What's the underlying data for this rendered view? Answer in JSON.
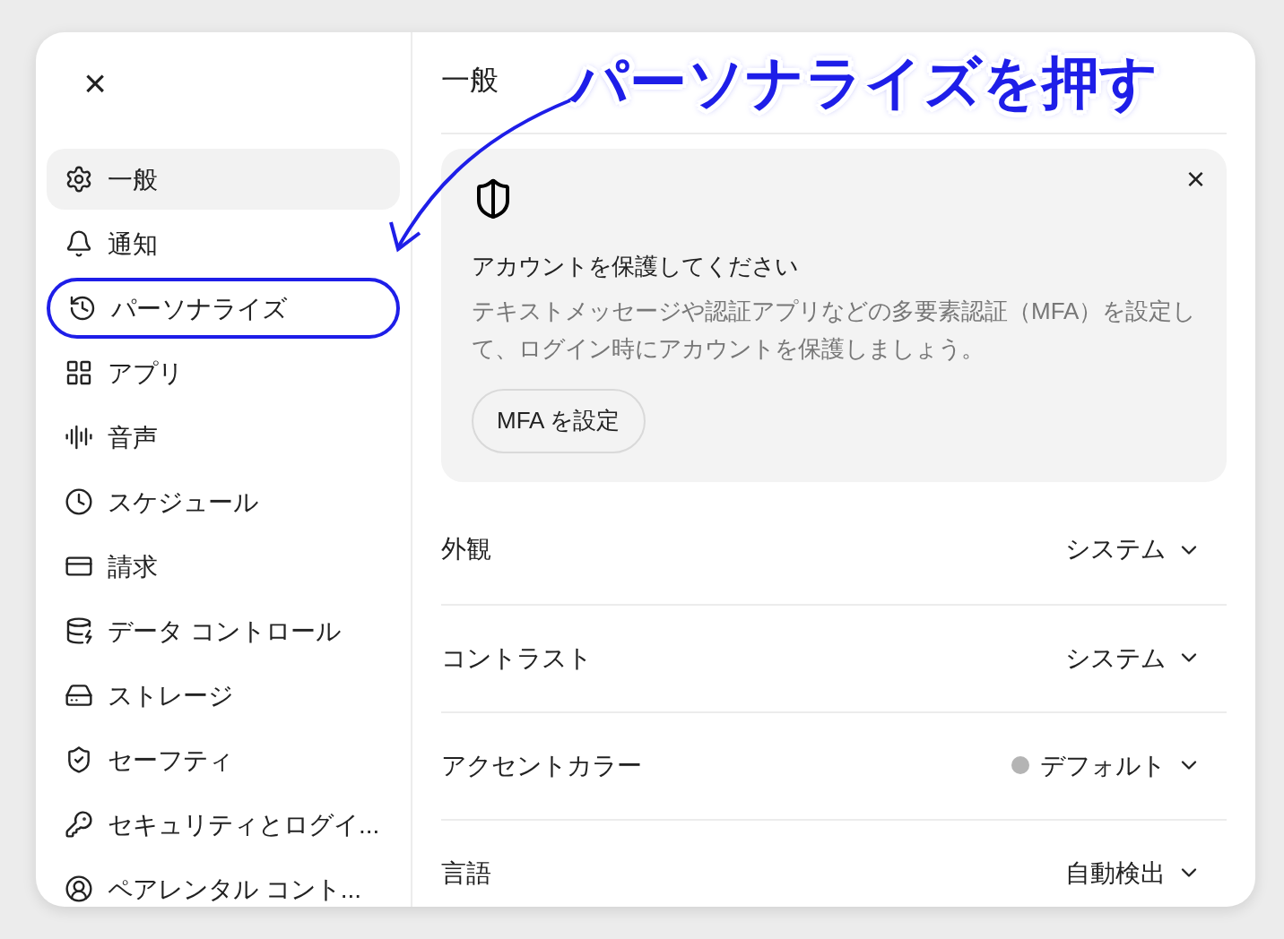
{
  "sidebar": {
    "close": "×",
    "items": [
      {
        "label": "一般",
        "selected": true,
        "highlighted": false
      },
      {
        "label": "通知",
        "selected": false,
        "highlighted": false
      },
      {
        "label": "パーソナライズ",
        "selected": false,
        "highlighted": true
      },
      {
        "label": "アプリ",
        "selected": false,
        "highlighted": false
      },
      {
        "label": "音声",
        "selected": false,
        "highlighted": false
      },
      {
        "label": "スケジュール",
        "selected": false,
        "highlighted": false
      },
      {
        "label": "請求",
        "selected": false,
        "highlighted": false
      },
      {
        "label": "データ コントロール",
        "selected": false,
        "highlighted": false
      },
      {
        "label": "ストレージ",
        "selected": false,
        "highlighted": false
      },
      {
        "label": "セーフティ",
        "selected": false,
        "highlighted": false
      },
      {
        "label": "セキュリティとログイ...",
        "selected": false,
        "highlighted": false
      },
      {
        "label": "ペアレンタル コント...",
        "selected": false,
        "highlighted": false
      }
    ]
  },
  "panel": {
    "title": "一般",
    "banner": {
      "close": "×",
      "title": "アカウントを保護してください",
      "body": "テキストメッセージや認証アプリなどの多要素認証（MFA）を設定して、ログイン時にアカウントを保護しましょう。",
      "button": "MFA を設定"
    },
    "settings": [
      {
        "label": "外観",
        "value": "システム"
      },
      {
        "label": "コントラスト",
        "value": "システム"
      },
      {
        "label": "アクセントカラー",
        "value": "デフォルト",
        "color": "#b4b4b4"
      },
      {
        "label": "言語",
        "value": "自動検出"
      }
    ]
  },
  "annotation": {
    "text": "パーソナライズを押す"
  }
}
